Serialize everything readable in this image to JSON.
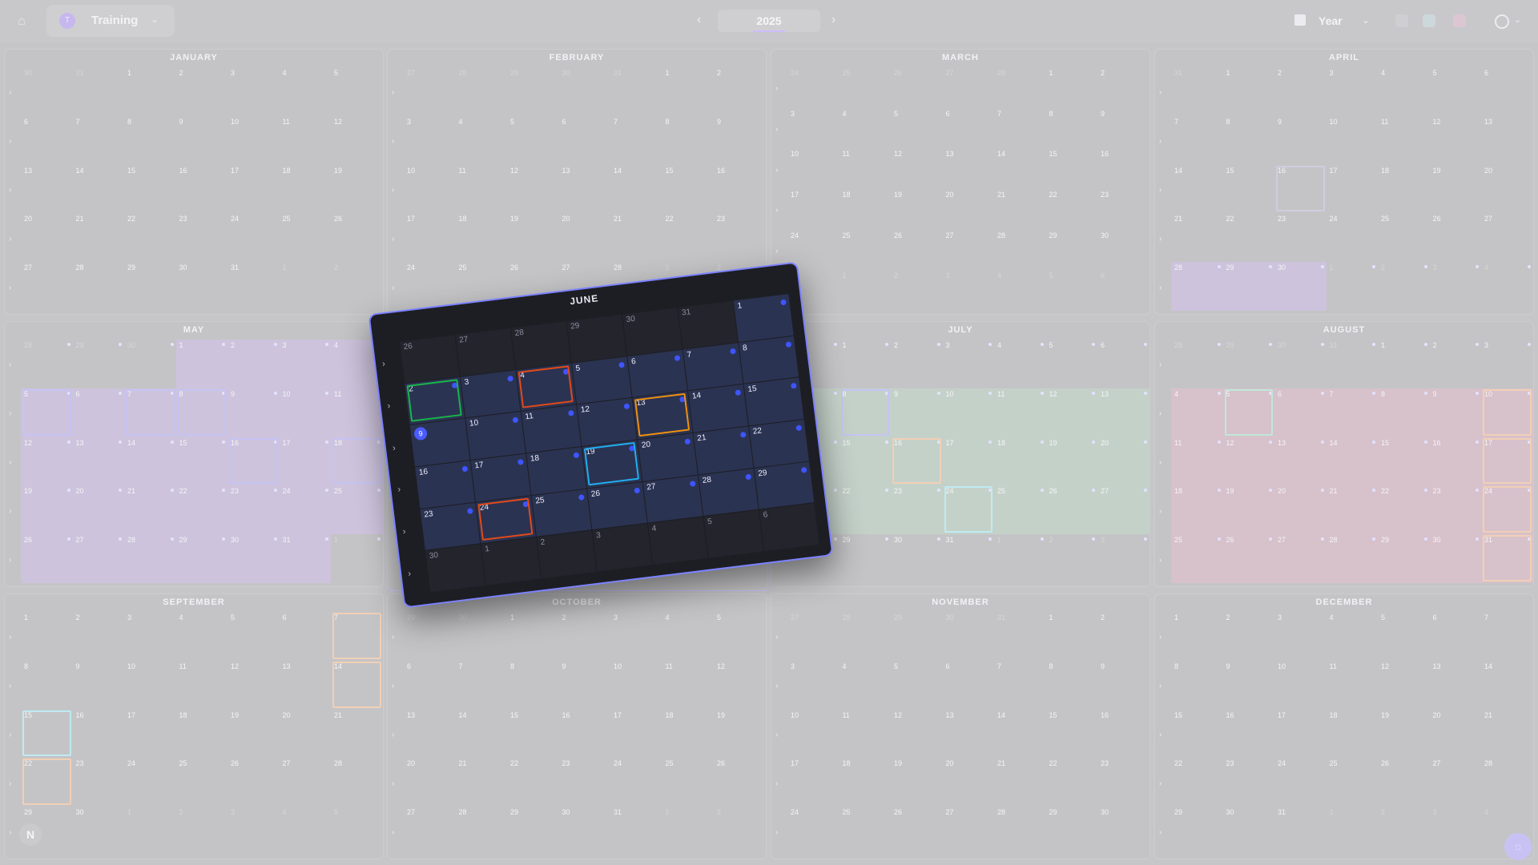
{
  "app": {
    "workspace_name": "Training",
    "workspace_avatar": "T",
    "year": "2025",
    "view_label": "Year",
    "nav_prev": "‹",
    "nav_next": "›"
  },
  "colors": {
    "accent": "#4b5cff",
    "green": "#18b54a",
    "red": "#e24a1a",
    "orange": "#f0900f",
    "blue": "#1fb0f0"
  },
  "icons": {
    "home": "home-icon",
    "calendar": "calendar-icon",
    "user": "user-icon",
    "chat": "chat-icon"
  },
  "badge": "N",
  "months": [
    {
      "name": "JANUARY",
      "weeks": [
        [
          "30",
          "31",
          "1",
          "2",
          "3",
          "4",
          "5"
        ],
        [
          "6",
          "7",
          "8",
          "9",
          "10",
          "11",
          "12"
        ],
        [
          "13",
          "14",
          "15",
          "16",
          "17",
          "18",
          "19"
        ],
        [
          "20",
          "21",
          "22",
          "23",
          "24",
          "25",
          "26"
        ],
        [
          "27",
          "28",
          "29",
          "30",
          "31",
          "1",
          "2"
        ]
      ]
    },
    {
      "name": "FEBRUARY",
      "weeks": [
        [
          "27",
          "28",
          "29",
          "30",
          "31",
          "1",
          "2"
        ],
        [
          "3",
          "4",
          "5",
          "6",
          "7",
          "8",
          "9"
        ],
        [
          "10",
          "11",
          "12",
          "13",
          "14",
          "15",
          "16"
        ],
        [
          "17",
          "18",
          "19",
          "20",
          "21",
          "22",
          "23"
        ],
        [
          "24",
          "25",
          "26",
          "27",
          "28",
          "1",
          "2"
        ]
      ]
    },
    {
      "name": "MARCH",
      "weeks": [
        [
          "24",
          "25",
          "26",
          "27",
          "28",
          "1",
          "2"
        ],
        [
          "3",
          "4",
          "5",
          "6",
          "7",
          "8",
          "9"
        ],
        [
          "10",
          "11",
          "12",
          "13",
          "14",
          "15",
          "16"
        ],
        [
          "17",
          "18",
          "19",
          "20",
          "21",
          "22",
          "23"
        ],
        [
          "24",
          "25",
          "26",
          "27",
          "28",
          "29",
          "30"
        ],
        [
          "31",
          "1",
          "2",
          "3",
          "4",
          "5",
          "6"
        ]
      ]
    },
    {
      "name": "APRIL",
      "weeks": [
        [
          "31",
          "1",
          "2",
          "3",
          "4",
          "5",
          "6"
        ],
        [
          "7",
          "8",
          "9",
          "10",
          "11",
          "12",
          "13"
        ],
        [
          "14",
          "15",
          "16",
          "17",
          "18",
          "19",
          "20"
        ],
        [
          "21",
          "22",
          "23",
          "24",
          "25",
          "26",
          "27"
        ],
        [
          "28",
          "29",
          "30",
          "1",
          "2",
          "3",
          "4"
        ]
      ]
    },
    {
      "name": "MAY",
      "weeks": [
        [
          "28",
          "29",
          "30",
          "1",
          "2",
          "3",
          "4"
        ],
        [
          "5",
          "6",
          "7",
          "8",
          "9",
          "10",
          "11"
        ],
        [
          "12",
          "13",
          "14",
          "15",
          "16",
          "17",
          "18"
        ],
        [
          "19",
          "20",
          "21",
          "22",
          "23",
          "24",
          "25"
        ],
        [
          "26",
          "27",
          "28",
          "29",
          "30",
          "31",
          "1"
        ]
      ]
    },
    {
      "name": "JUNE",
      "weeks": [
        [
          "26",
          "27",
          "28",
          "29",
          "30",
          "31",
          "1"
        ],
        [
          "2",
          "3",
          "4",
          "5",
          "6",
          "7",
          "8"
        ],
        [
          "9",
          "10",
          "11",
          "12",
          "13",
          "14",
          "15"
        ],
        [
          "16",
          "17",
          "18",
          "19",
          "20",
          "21",
          "22"
        ],
        [
          "23",
          "24",
          "25",
          "26",
          "27",
          "28",
          "29"
        ],
        [
          "30",
          "1",
          "2",
          "3",
          "4",
          "5",
          "6"
        ]
      ]
    },
    {
      "name": "JULY",
      "weeks": [
        [
          "30",
          "1",
          "2",
          "3",
          "4",
          "5",
          "6"
        ],
        [
          "7",
          "8",
          "9",
          "10",
          "11",
          "12",
          "13"
        ],
        [
          "14",
          "15",
          "16",
          "17",
          "18",
          "19",
          "20"
        ],
        [
          "21",
          "22",
          "23",
          "24",
          "25",
          "26",
          "27"
        ],
        [
          "28",
          "29",
          "30",
          "31",
          "1",
          "2",
          "3"
        ]
      ]
    },
    {
      "name": "AUGUST",
      "weeks": [
        [
          "28",
          "29",
          "30",
          "31",
          "1",
          "2",
          "3"
        ],
        [
          "4",
          "5",
          "6",
          "7",
          "8",
          "9",
          "10"
        ],
        [
          "11",
          "12",
          "13",
          "14",
          "15",
          "16",
          "17"
        ],
        [
          "18",
          "19",
          "20",
          "21",
          "22",
          "23",
          "24"
        ],
        [
          "25",
          "26",
          "27",
          "28",
          "29",
          "30",
          "31"
        ]
      ]
    },
    {
      "name": "SEPTEMBER",
      "weeks": [
        [
          "1",
          "2",
          "3",
          "4",
          "5",
          "6",
          "7"
        ],
        [
          "8",
          "9",
          "10",
          "11",
          "12",
          "13",
          "14"
        ],
        [
          "15",
          "16",
          "17",
          "18",
          "19",
          "20",
          "21"
        ],
        [
          "22",
          "23",
          "24",
          "25",
          "26",
          "27",
          "28"
        ],
        [
          "29",
          "30",
          "1",
          "2",
          "3",
          "4",
          "5"
        ]
      ]
    },
    {
      "name": "OCTOBER",
      "weeks": [
        [
          "29",
          "30",
          "1",
          "2",
          "3",
          "4",
          "5"
        ],
        [
          "6",
          "7",
          "8",
          "9",
          "10",
          "11",
          "12"
        ],
        [
          "13",
          "14",
          "15",
          "16",
          "17",
          "18",
          "19"
        ],
        [
          "20",
          "21",
          "22",
          "23",
          "24",
          "25",
          "26"
        ],
        [
          "27",
          "28",
          "29",
          "30",
          "31",
          "1",
          "2"
        ]
      ]
    },
    {
      "name": "NOVEMBER",
      "weeks": [
        [
          "27",
          "28",
          "29",
          "30",
          "31",
          "1",
          "2"
        ],
        [
          "3",
          "4",
          "5",
          "6",
          "7",
          "8",
          "9"
        ],
        [
          "10",
          "11",
          "12",
          "13",
          "14",
          "15",
          "16"
        ],
        [
          "17",
          "18",
          "19",
          "20",
          "21",
          "22",
          "23"
        ],
        [
          "24",
          "25",
          "26",
          "27",
          "28",
          "29",
          "30"
        ]
      ]
    },
    {
      "name": "DECEMBER",
      "weeks": [
        [
          "1",
          "2",
          "3",
          "4",
          "5",
          "6",
          "7"
        ],
        [
          "8",
          "9",
          "10",
          "11",
          "12",
          "13",
          "14"
        ],
        [
          "15",
          "16",
          "17",
          "18",
          "19",
          "20",
          "21"
        ],
        [
          "22",
          "23",
          "24",
          "25",
          "26",
          "27",
          "28"
        ],
        [
          "29",
          "30",
          "31",
          "1",
          "2",
          "3",
          "4"
        ]
      ]
    }
  ],
  "june_overlay": {
    "title": "JUNE",
    "today": "9"
  }
}
